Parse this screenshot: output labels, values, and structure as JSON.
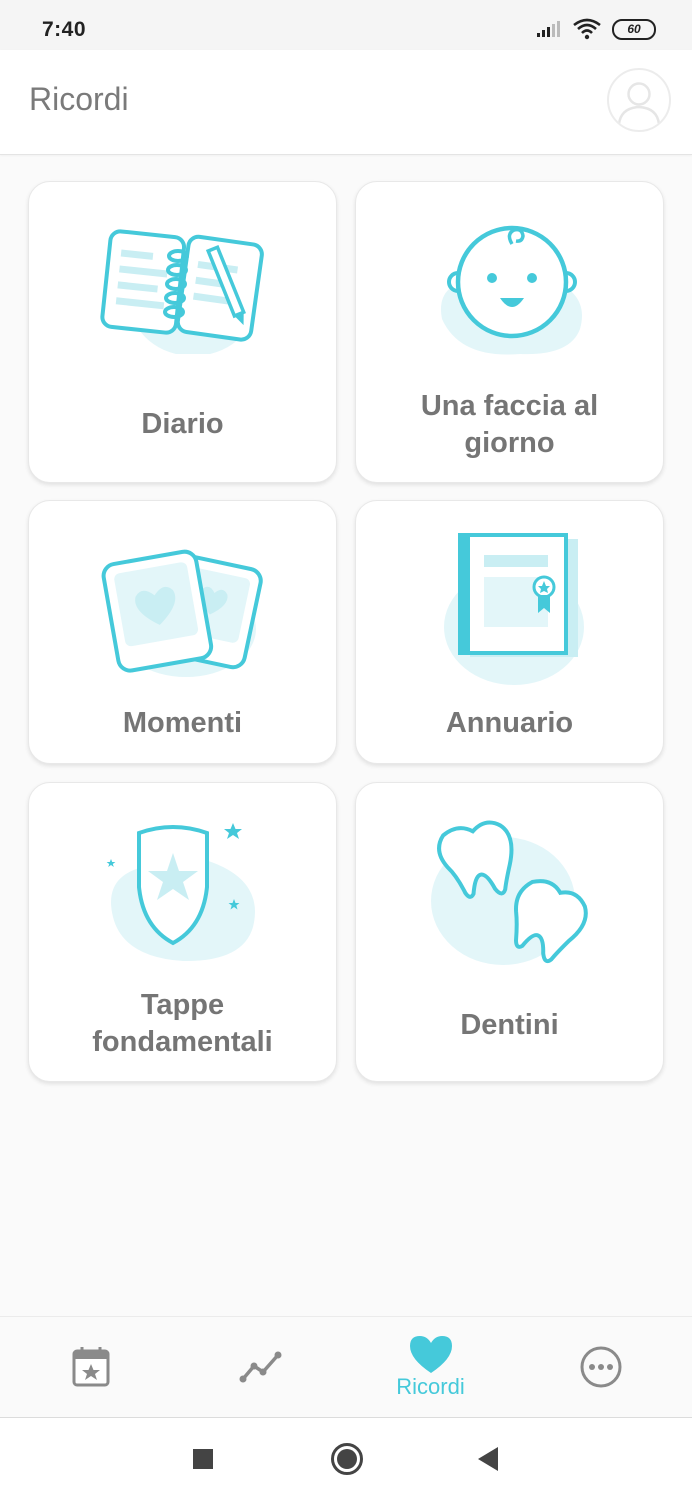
{
  "status_bar": {
    "time": "7:40",
    "battery": "60",
    "icons": [
      "signal-icon",
      "wifi-icon",
      "battery-icon"
    ]
  },
  "header": {
    "title": "Ricordi",
    "avatar_icon": "user-avatar-icon"
  },
  "cards": [
    {
      "id": "diario",
      "label": "Diario",
      "icon": "diary-notebook-icon"
    },
    {
      "id": "faccia",
      "label": "Una faccia al giorno",
      "icon": "baby-face-icon"
    },
    {
      "id": "momenti",
      "label": "Momenti",
      "icon": "photos-heart-icon"
    },
    {
      "id": "annuario",
      "label": "Annuario",
      "icon": "yearbook-icon"
    },
    {
      "id": "tappe",
      "label": "Tappe fondamentali",
      "icon": "shield-star-icon"
    },
    {
      "id": "dentini",
      "label": "Dentini",
      "icon": "teeth-icon"
    }
  ],
  "bottom_nav": {
    "active": "Ricordi",
    "items": [
      {
        "icon": "calendar-star-icon",
        "label": ""
      },
      {
        "icon": "growth-chart-icon",
        "label": ""
      },
      {
        "icon": "heart-icon",
        "label": "Ricordi"
      },
      {
        "icon": "more-icon",
        "label": ""
      }
    ]
  },
  "colors": {
    "accent": "#45c9da",
    "accent_light": "#e3f6f9",
    "text": "#757575",
    "background": "#fafafa"
  }
}
